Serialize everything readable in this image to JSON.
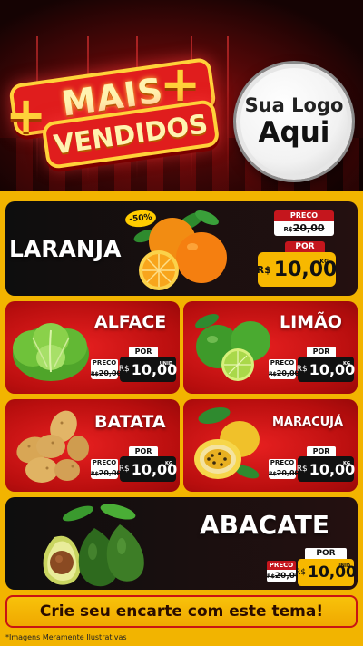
{
  "header": {
    "title_line1": "MAIS",
    "title_line2": "VENDIDOS",
    "plus_symbol": "+",
    "logo_line1": "Sua Logo",
    "logo_line2": "Aqui"
  },
  "featured": {
    "name": "LARANJA",
    "discount_badge": "-50%",
    "preco_label": "PRECO",
    "old_currency": "R$",
    "old_price": "20,00",
    "por_label": "POR",
    "new_currency": "R$",
    "new_price": "10,00",
    "unit": "KG",
    "icon": "orange-icon"
  },
  "products": [
    {
      "name": "ALFACE",
      "preco_label": "PRECO",
      "old_currency": "R$",
      "old_price": "20,00",
      "por_label": "POR",
      "new_currency": "R$",
      "new_price": "10,00",
      "unit": "UNID",
      "icon": "lettuce-icon"
    },
    {
      "name": "LIMÃO",
      "preco_label": "PRECO",
      "old_currency": "R$",
      "old_price": "20,00",
      "por_label": "POR",
      "new_currency": "R$",
      "new_price": "10,00",
      "unit": "KG",
      "icon": "lime-icon"
    },
    {
      "name": "BATATA",
      "preco_label": "PRECO",
      "old_currency": "R$",
      "old_price": "20,00",
      "por_label": "POR",
      "new_currency": "R$",
      "new_price": "10,00",
      "unit": "KG",
      "icon": "potato-icon"
    },
    {
      "name": "MARACUJÁ",
      "preco_label": "PRECO",
      "old_currency": "R$",
      "old_price": "20,00",
      "por_label": "POR",
      "new_currency": "R$",
      "new_price": "10,00",
      "unit": "KG",
      "icon": "passion-fruit-icon"
    },
    {
      "name": "ABACATE",
      "preco_label": "PRECO",
      "old_currency": "R$",
      "old_price": "20,00",
      "por_label": "POR",
      "new_currency": "R$",
      "new_price": "10,00",
      "unit": "UNID",
      "icon": "avocado-icon"
    }
  ],
  "footer": {
    "cta": "Crie seu encarte com este tema!",
    "disclaimer": "*Imagens Meramente Ilustrativas"
  },
  "colors": {
    "brand_red": "#c5161d",
    "accent_yellow": "#f2b400",
    "dark": "#111111"
  }
}
